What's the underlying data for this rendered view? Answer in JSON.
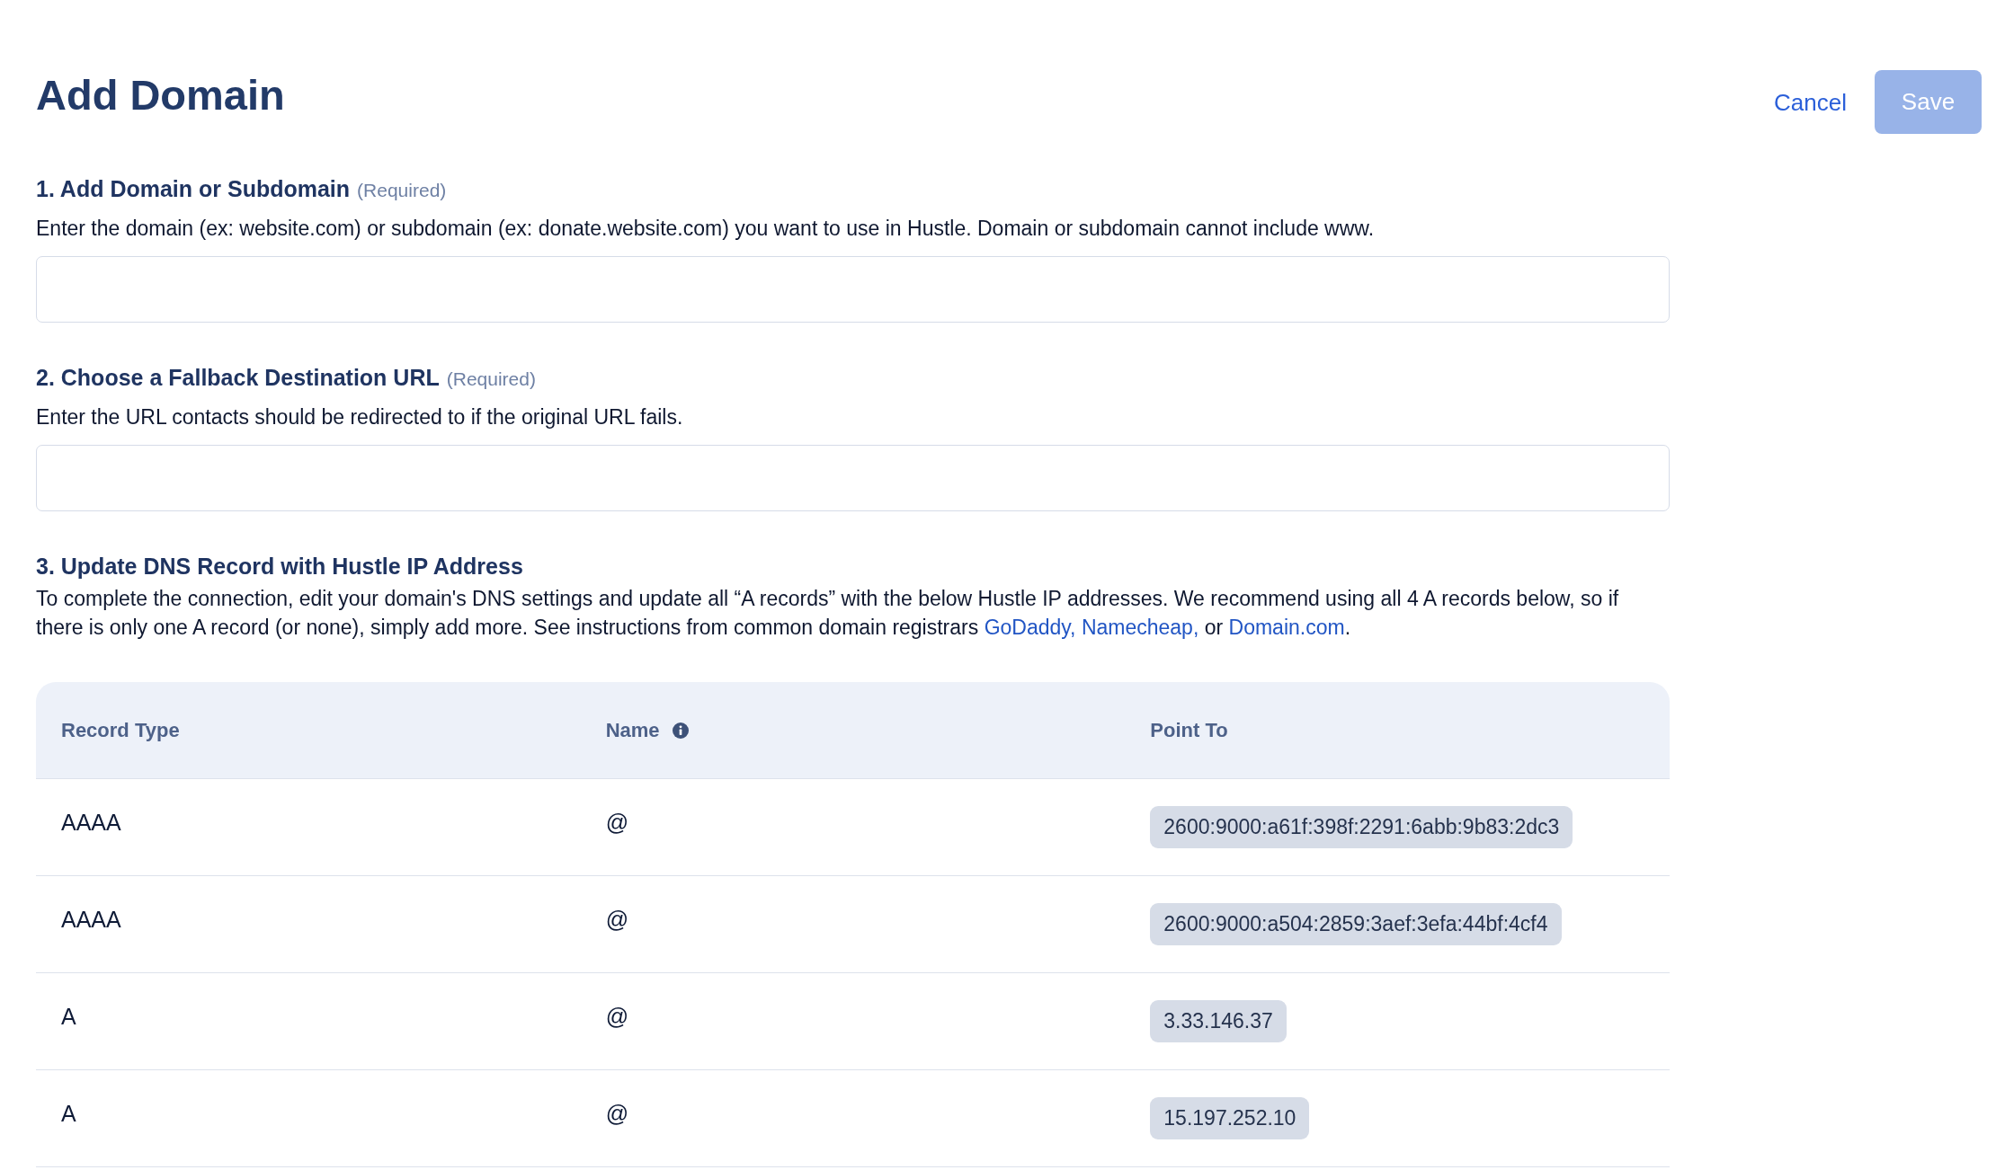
{
  "header": {
    "title": "Add Domain",
    "actions": [
      {
        "kind": "link",
        "label": "Cancel",
        "disabled": false
      },
      {
        "kind": "primary",
        "label": "Save",
        "disabled": true
      }
    ]
  },
  "steps": [
    {
      "kind": "input",
      "heading": "1. Add Domain or Subdomain",
      "note": "(Required)",
      "description": "Enter the domain (ex: website.com) or subdomain (ex: donate.website.com) you want to use in Hustle. Domain or subdomain cannot include www."
    },
    {
      "kind": "input",
      "heading": "2. Choose a Fallback Destination URL",
      "note": "(Required)",
      "description": "Enter the URL contacts should be redirected to if the original URL fails."
    },
    {
      "kind": "dns",
      "heading": "3. Update DNS Record with Hustle IP Address",
      "description": [
        {
          "kind": "text",
          "text": "To complete the connection, edit your domain's DNS settings and update all “A records” with the below Hustle IP addresses. We recommend using all 4 A records below, so if there is only one A record (or none), simply add more. See instructions from common domain registrars "
        },
        {
          "kind": "link",
          "text": "GoDaddy,"
        },
        {
          "kind": "link",
          "text": "Namecheap,"
        },
        {
          "kind": "text",
          "text": " or "
        },
        {
          "kind": "link",
          "text": "Domain.com"
        },
        {
          "kind": "text",
          "text": "."
        }
      ],
      "table": {
        "columns": [
          {
            "label": "Record Type",
            "kind": "text",
            "info": false
          },
          {
            "label": "Name",
            "kind": "text",
            "info": true
          },
          {
            "label": "Point To",
            "kind": "chip",
            "info": false
          }
        ],
        "rows": [
          {
            "cells": [
              "AAAA",
              "@",
              "2600:9000:a61f:398f:2291:6abb:9b83:2dc3"
            ]
          },
          {
            "cells": [
              "AAAA",
              "@",
              "2600:9000:a504:2859:3aef:3efa:44bf:4cf4"
            ]
          },
          {
            "cells": [
              "A",
              "@",
              "3.33.146.37"
            ]
          },
          {
            "cells": [
              "A",
              "@",
              "15.197.252.10"
            ]
          }
        ]
      }
    }
  ]
}
